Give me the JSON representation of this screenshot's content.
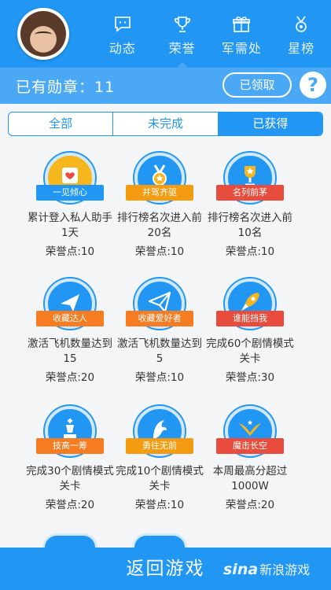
{
  "nav": {
    "items": [
      {
        "label": "动态",
        "icon": "chat-icon"
      },
      {
        "label": "荣誉",
        "icon": "trophy-icon"
      },
      {
        "label": "军需处",
        "icon": "gift-icon"
      },
      {
        "label": "星榜",
        "icon": "medal-icon"
      }
    ],
    "active": 1
  },
  "medal_bar": {
    "count_text": "已有勋章：11",
    "claimed_label": "已领取",
    "help_label": "?"
  },
  "tabs": {
    "items": [
      "全部",
      "未完成",
      "已获得"
    ],
    "active": 2
  },
  "badges": [
    {
      "name": "一见倾心",
      "desc": "累计登入私人助手1天",
      "points": "荣誉点:10",
      "ribbon_color": "#2196f3",
      "disc_color": "#f5b61e",
      "icon": "heart-phone-icon"
    },
    {
      "name": "并驾齐驱",
      "desc": "排行榜名次进入前20名",
      "points": "荣誉点:10",
      "ribbon_color": "#f39c12",
      "disc_color": "#2196f3",
      "icon": "medal-icon"
    },
    {
      "name": "名列前茅",
      "desc": "排行榜名次进入前10名",
      "points": "荣誉点:10",
      "ribbon_color": "#e74c3c",
      "disc_color": "#2196f3",
      "icon": "trophy-icon"
    },
    {
      "name": "收藏达人",
      "desc": "激活飞机数量达到15",
      "points": "荣誉点:20",
      "ribbon_color": "#f57c20",
      "disc_color": "#2196f3",
      "icon": "plane-icon"
    },
    {
      "name": "收藏爱好者",
      "desc": "激活飞机数量达到5",
      "points": "荣誉点:10",
      "ribbon_color": "#f57c20",
      "disc_color": "#2196f3",
      "icon": "paper-plane-icon"
    },
    {
      "name": "谁能挡我",
      "desc": "完成60个剧情模式关卡",
      "points": "荣誉点:30",
      "ribbon_color": "#e74c3c",
      "disc_color": "#2196f3",
      "icon": "rocket-icon"
    },
    {
      "name": "技高一筹",
      "desc": "完成30个剧情模式关卡",
      "points": "荣誉点:20",
      "ribbon_color": "#f57c20",
      "disc_color": "#2196f3",
      "icon": "chess-king-icon"
    },
    {
      "name": "勇往无前",
      "desc": "完成10个剧情模式关卡",
      "points": "荣誉点:10",
      "ribbon_color": "#f39c12",
      "disc_color": "#2196f3",
      "icon": "eagle-icon"
    },
    {
      "name": "魔击长空",
      "desc": "本周最高分超过1000W",
      "points": "荣誉点:20",
      "ribbon_color": "#e74c3c",
      "disc_color": "#2196f3",
      "icon": "wings-icon"
    }
  ],
  "footer": {
    "back_label": "返回游戏",
    "watermark": "新浪游戏",
    "watermark_brand": "sina"
  }
}
